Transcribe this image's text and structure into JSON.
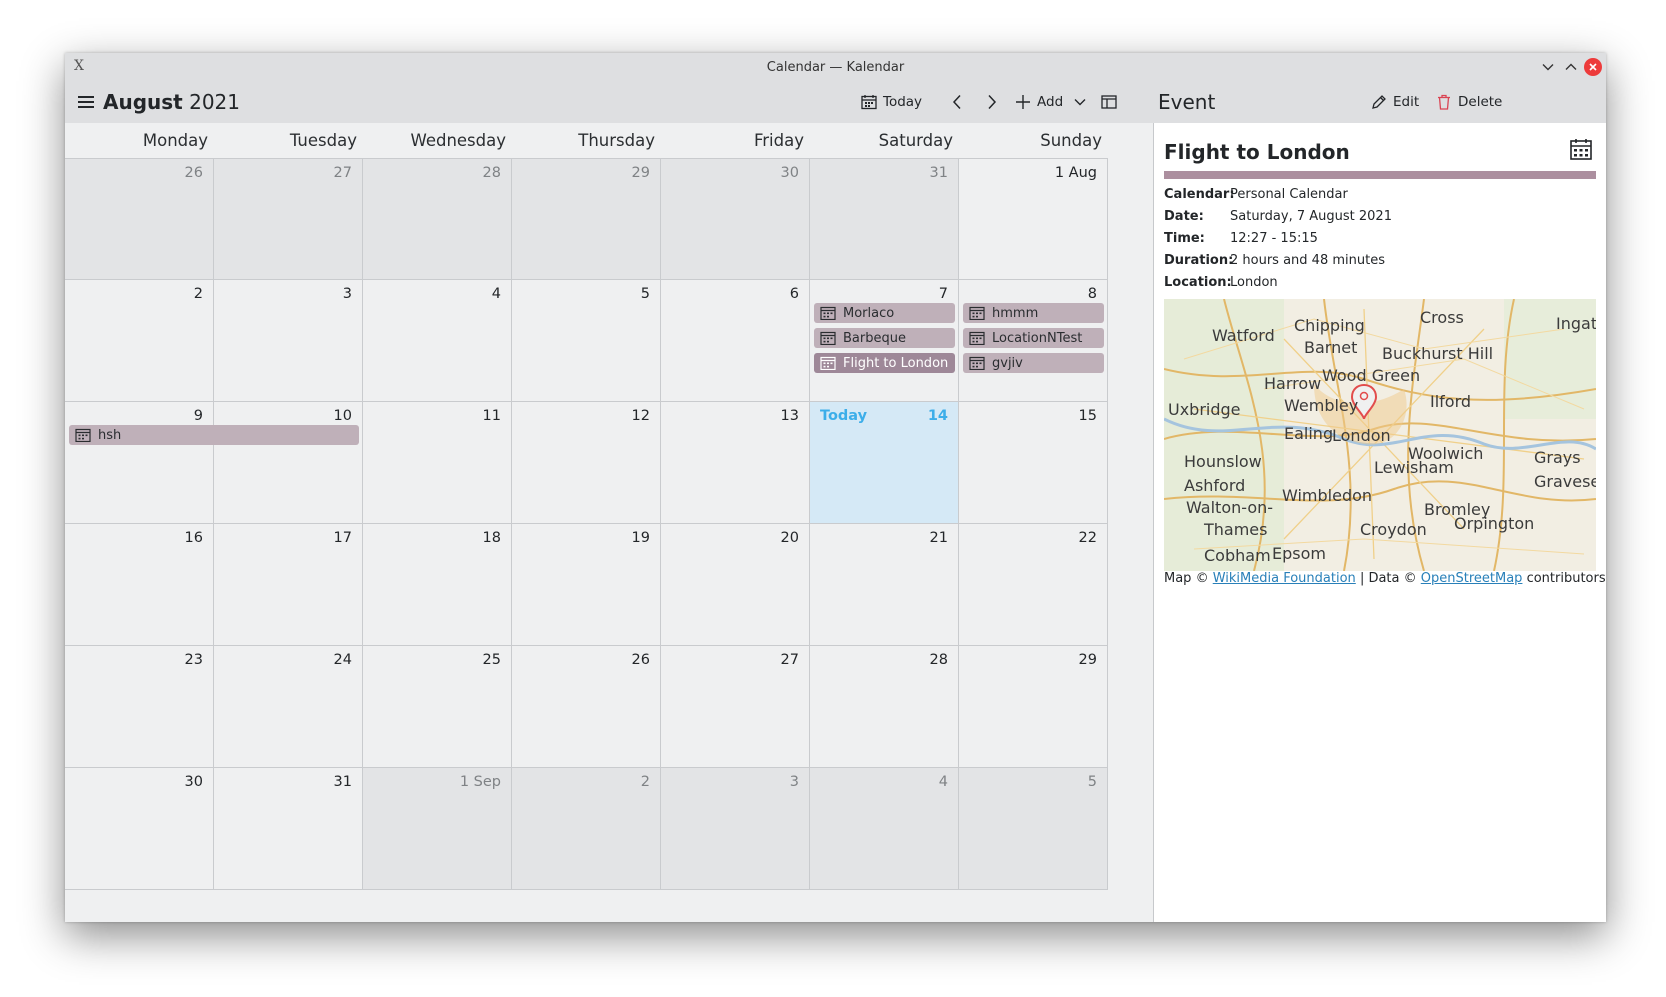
{
  "window": {
    "title": "Calendar — Kalendar",
    "app_icon": "X"
  },
  "toolbar": {
    "month": "August",
    "year": "2021",
    "today_label": "Today",
    "add_label": "Add",
    "edit_label": "Edit",
    "delete_label": "Delete",
    "panel_title": "Event"
  },
  "weekdays": [
    "Monday",
    "Tuesday",
    "Wednesday",
    "Thursday",
    "Friday",
    "Saturday",
    "Sunday"
  ],
  "weeks": [
    [
      {
        "label": "26",
        "out": true
      },
      {
        "label": "27",
        "out": true
      },
      {
        "label": "28",
        "out": true
      },
      {
        "label": "29",
        "out": true
      },
      {
        "label": "30",
        "out": true
      },
      {
        "label": "31",
        "out": true
      },
      {
        "label": "1 Aug",
        "out": false
      }
    ],
    [
      {
        "label": "2"
      },
      {
        "label": "3"
      },
      {
        "label": "4"
      },
      {
        "label": "5"
      },
      {
        "label": "6"
      },
      {
        "label": "7"
      },
      {
        "label": "8"
      }
    ],
    [
      {
        "label": "9"
      },
      {
        "label": "10"
      },
      {
        "label": "11"
      },
      {
        "label": "12"
      },
      {
        "label": "13"
      },
      {
        "label": "14",
        "today": true
      },
      {
        "label": "15"
      }
    ],
    [
      {
        "label": "16"
      },
      {
        "label": "17"
      },
      {
        "label": "18"
      },
      {
        "label": "19"
      },
      {
        "label": "20"
      },
      {
        "label": "21"
      },
      {
        "label": "22"
      }
    ],
    [
      {
        "label": "23"
      },
      {
        "label": "24"
      },
      {
        "label": "25"
      },
      {
        "label": "26"
      },
      {
        "label": "27"
      },
      {
        "label": "28"
      },
      {
        "label": "29"
      }
    ],
    [
      {
        "label": "30"
      },
      {
        "label": "31"
      },
      {
        "label": "1 Sep",
        "out": true
      },
      {
        "label": "2",
        "out": true
      },
      {
        "label": "3",
        "out": true
      },
      {
        "label": "4",
        "out": true
      },
      {
        "label": "5",
        "out": true
      }
    ]
  ],
  "today_text": "Today",
  "events": [
    {
      "title": "Morlaco",
      "week": 1,
      "day": 5,
      "span": 1,
      "slot": 0
    },
    {
      "title": "Barbeque",
      "week": 1,
      "day": 5,
      "span": 1,
      "slot": 1
    },
    {
      "title": "Flight to London",
      "week": 1,
      "day": 5,
      "span": 1,
      "slot": 2,
      "selected": true
    },
    {
      "title": "hmmm",
      "week": 1,
      "day": 6,
      "span": 1,
      "slot": 0
    },
    {
      "title": "LocationNTest",
      "week": 1,
      "day": 6,
      "span": 1,
      "slot": 1
    },
    {
      "title": "gvjiv",
      "week": 1,
      "day": 6,
      "span": 1,
      "slot": 2
    },
    {
      "title": "hsh",
      "week": 2,
      "day": 0,
      "span": 2,
      "slot": 0
    }
  ],
  "event_detail": {
    "title": "Flight to London",
    "color": "#ac8f9f",
    "fields": [
      {
        "key": "Calendar:",
        "value": "Personal Calendar"
      },
      {
        "key": "Date:",
        "value": "Saturday, 7 August 2021"
      },
      {
        "key": "Time:",
        "value": "12:27 - 15:15"
      },
      {
        "key": "Duration:",
        "value": "2 hours and 48 minutes"
      },
      {
        "key": "Location:",
        "value": "London"
      }
    ]
  },
  "map": {
    "places": [
      "Watford",
      "Chipping",
      "Barnet",
      "Cross",
      "Ingates",
      "Buckhurst Hill",
      "Harrow",
      "Wood Green",
      "Uxbridge",
      "Wembley",
      "Ilford",
      "Ealing",
      "London",
      "Hounslow",
      "Woolwich",
      "Lewisham",
      "Grays",
      "Ashford",
      "Wimbledon",
      "Walton-on-",
      "Thames",
      "Bromley",
      "Orpington",
      "Croydon",
      "Cobham",
      "Epsom",
      "Gravesend"
    ],
    "attribution_prefix": "Map ©",
    "attribution_link1": "WikiMedia Foundation",
    "attribution_mid": "| Data ©",
    "attribution_link2": "OpenStreetMap",
    "attribution_suffix": "contributors"
  },
  "colors": {
    "accent": "#3daee9",
    "event_bg": "#bfb0b9",
    "event_selected": "#9e8898",
    "today_bg": "#d5e9f6"
  }
}
